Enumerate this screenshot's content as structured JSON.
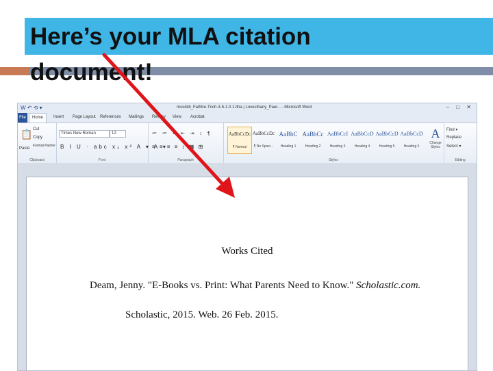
{
  "slide": {
    "title_line1": "Here’s your MLA citation",
    "title_line2": "document!"
  },
  "colors": {
    "title_banner": "#3fb6e6",
    "deco_bar": "#7f8da6",
    "deco_accent": "#c87a55",
    "arrow": "#e0141b"
  },
  "word": {
    "window_title": "msx4kb_Fa08re-Tnch-3-5-1.0.1.ltha | Lovesthany_Paer... - Microsoft Word",
    "quick_access": "W ↶ ⟲ ▾",
    "window_controls": "– □ ✕",
    "file_tab": "File",
    "tabs": [
      "Home",
      "Insert",
      "Page Layout",
      "References",
      "Mailings",
      "Review",
      "View",
      "Acrobat"
    ],
    "ribbon": {
      "clipboard": {
        "paste": "Paste",
        "cut": "Cut",
        "copy": "Copy",
        "format_painter": "Format Painter",
        "label": "Clipboard"
      },
      "font": {
        "name": "Times New Roman",
        "size": "12",
        "format_icons": "B I U · abc x₂ x² A ▾ A ▾",
        "label": "Font"
      },
      "paragraph": {
        "top_icons": "≔ ≔ ≡ ⇤ ⇥ ↕ ¶",
        "bottom_icons": "≡ ≡ ≡ ≡ ↕ ▦ ⊞",
        "label": "Paragraph"
      },
      "styles": {
        "items": [
          {
            "sample": "AaBbCcDc",
            "name": "¶ Normal"
          },
          {
            "sample": "AaBbCcDc",
            "name": "¶ No Spaci..."
          },
          {
            "sample": "AaBbC",
            "name": "Heading 1"
          },
          {
            "sample": "AaBbCc",
            "name": "Heading 2"
          },
          {
            "sample": "AaBbCcI",
            "name": "Heading 3"
          },
          {
            "sample": "AaBbCcD",
            "name": "Heading 4"
          },
          {
            "sample": "AaBbCcD",
            "name": "Heading 5"
          },
          {
            "sample": "AaBbCcD",
            "name": "Heading 6"
          }
        ],
        "change_styles": "Change Styles",
        "label": "Styles"
      },
      "editing": {
        "find": "Find ▾",
        "replace": "Replace",
        "select": "Select ▾",
        "label": "Editing"
      }
    }
  },
  "document": {
    "heading": "Works Cited",
    "entry_line1_prefix": "Deam, Jenny. \"E-Books vs. Print: What Parents Need to Know.\" ",
    "entry_line1_italic": "Scholastic.com.",
    "entry_line2": "Scholastic, 2015. Web. 26 Feb. 2015."
  }
}
